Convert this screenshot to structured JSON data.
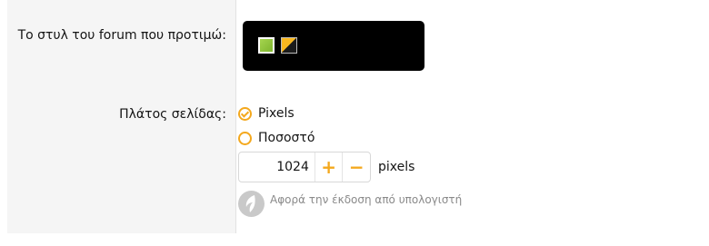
{
  "style_row": {
    "label": "Το στυλ του forum που προτιμώ:",
    "styles": [
      {
        "name": "green-style",
        "color": "#8cc63f",
        "selected": true
      },
      {
        "name": "orange-dark-style",
        "color": "#f9b820",
        "selected": false
      }
    ]
  },
  "width_row": {
    "label": "Πλάτος σελίδας:",
    "options": [
      {
        "label": "Pixels",
        "checked": true
      },
      {
        "label": "Ποσοστό",
        "checked": false
      }
    ],
    "stepper": {
      "value": "1024",
      "plus_label": "+",
      "minus_label": "−",
      "unit": "pixels"
    },
    "hint": "Αφορά την έκδοση από υπολογιστή"
  },
  "colors": {
    "accent": "#f4a81d",
    "label_column_bg": "#f5f5f5",
    "hint_text": "#8a8a8a"
  }
}
